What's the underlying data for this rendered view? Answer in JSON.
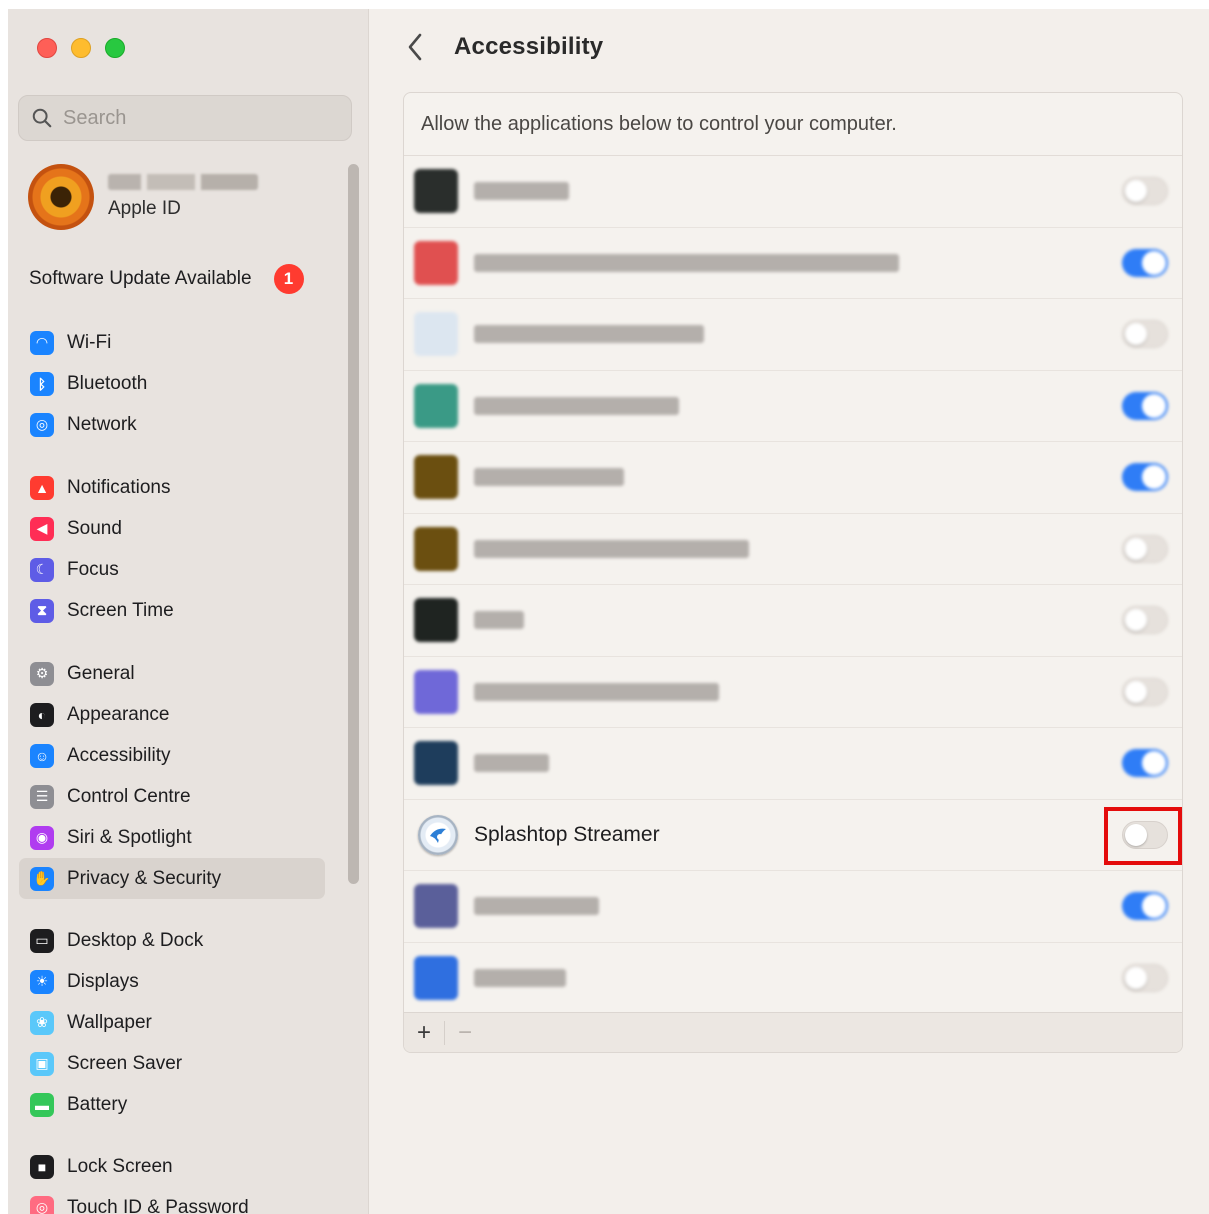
{
  "sidebar": {
    "search_placeholder": "Search",
    "apple_id_label": "Apple ID",
    "software_update": {
      "label": "Software Update Available",
      "badge": "1"
    },
    "groups": [
      [
        {
          "label": "Wi-Fi",
          "icon": "wifi-icon",
          "color": "#1a84ff"
        },
        {
          "label": "Bluetooth",
          "icon": "bluetooth-icon",
          "color": "#1a84ff"
        },
        {
          "label": "Network",
          "icon": "globe-icon",
          "color": "#1a84ff"
        }
      ],
      [
        {
          "label": "Notifications",
          "icon": "bell-icon",
          "color": "#ff3b30"
        },
        {
          "label": "Sound",
          "icon": "speaker-icon",
          "color": "#ff2d55"
        },
        {
          "label": "Focus",
          "icon": "moon-icon",
          "color": "#5e5ce6"
        },
        {
          "label": "Screen Time",
          "icon": "hourglass-icon",
          "color": "#5e5ce6"
        }
      ],
      [
        {
          "label": "General",
          "icon": "gear-icon",
          "color": "#8e8e93"
        },
        {
          "label": "Appearance",
          "icon": "appearance-icon",
          "color": "#1d1d1f"
        },
        {
          "label": "Accessibility",
          "icon": "accessibility-icon",
          "color": "#1a84ff"
        },
        {
          "label": "Control Centre",
          "icon": "control-centre-icon",
          "color": "#8e8e93"
        },
        {
          "label": "Siri & Spotlight",
          "icon": "siri-icon",
          "color": "#b03cf0"
        },
        {
          "label": "Privacy & Security",
          "icon": "hand-icon",
          "color": "#1a84ff",
          "selected": true
        }
      ],
      [
        {
          "label": "Desktop & Dock",
          "icon": "dock-icon",
          "color": "#1d1d1f"
        },
        {
          "label": "Displays",
          "icon": "sun-icon",
          "color": "#1a84ff"
        },
        {
          "label": "Wallpaper",
          "icon": "flower-icon",
          "color": "#5ac8fa"
        },
        {
          "label": "Screen Saver",
          "icon": "screensaver-icon",
          "color": "#5ac8fa"
        },
        {
          "label": "Battery",
          "icon": "battery-icon",
          "color": "#34c759"
        }
      ],
      [
        {
          "label": "Lock Screen",
          "icon": "lock-icon",
          "color": "#1d1d1f"
        },
        {
          "label": "Touch ID & Password",
          "icon": "fingerprint-icon",
          "color": "#ff6b81"
        }
      ]
    ]
  },
  "main": {
    "title": "Accessibility",
    "description": "Allow the applications below to control your computer.",
    "apps": [
      {
        "name_visible": false,
        "icon_color": "#2a2e2c",
        "enabled": false
      },
      {
        "name_visible": false,
        "icon_color": "#e05050",
        "enabled": true
      },
      {
        "name_visible": false,
        "icon_color": "#dce6f0",
        "enabled": false
      },
      {
        "name_visible": false,
        "icon_color": "#3a9a86",
        "enabled": true
      },
      {
        "name_visible": false,
        "icon_color": "#6b4f10",
        "enabled": true
      },
      {
        "name_visible": false,
        "icon_color": "#6b4f10",
        "enabled": false
      },
      {
        "name_visible": false,
        "icon_color": "#1f2421",
        "enabled": false
      },
      {
        "name_visible": false,
        "icon_color": "#6f68d8",
        "enabled": false
      },
      {
        "name_visible": false,
        "icon_color": "#1e3d5c",
        "enabled": true
      },
      {
        "name": "Splashtop Streamer",
        "name_visible": true,
        "icon": "splashtop-icon",
        "enabled": false,
        "highlighted": true
      },
      {
        "name_visible": false,
        "icon_color": "#5a5f9a",
        "enabled": true
      },
      {
        "name_visible": false,
        "icon_color": "#2f6fe0",
        "enabled": false
      }
    ],
    "footer": {
      "add": "+",
      "remove": "−"
    },
    "highlight_color": "#e40c0c"
  }
}
